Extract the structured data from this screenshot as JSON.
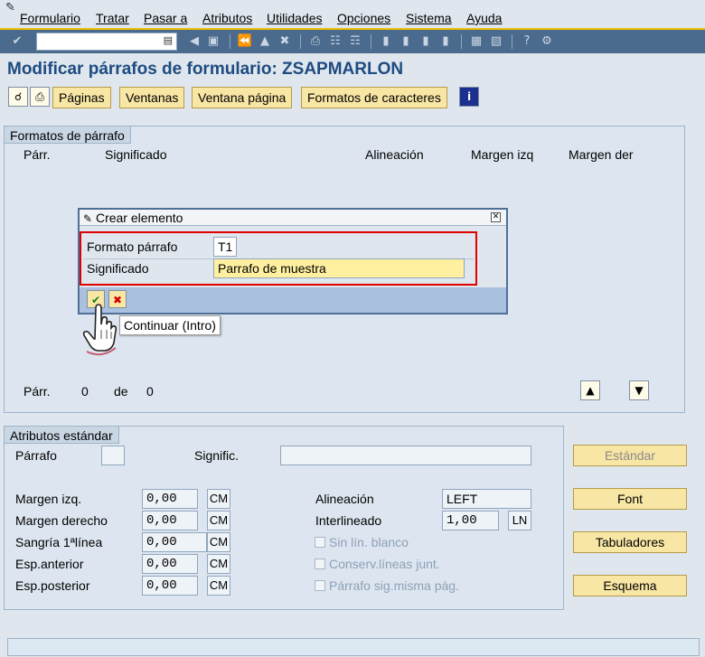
{
  "menubar": {
    "items": [
      "Formulario",
      "Tratar",
      "Pasar a",
      "Atributos",
      "Utilidades",
      "Opciones",
      "Sistema",
      "Ayuda"
    ]
  },
  "toolbar": {
    "command_value": ""
  },
  "page": {
    "title": "Modificar párrafos de formulario: ZSAPMARLON"
  },
  "appbar": {
    "buttons": [
      "Páginas",
      "Ventanas",
      "Ventana página",
      "Formatos de caracteres"
    ]
  },
  "paragraph_formats": {
    "group_title": "Formatos de párrafo",
    "columns": [
      "Párr.",
      "Significado",
      "Alineación",
      "Margen izq",
      "Margen der"
    ],
    "footer_label": "Párr.",
    "footer_count": "0",
    "footer_of": "de",
    "footer_total": "0"
  },
  "dialog": {
    "title": "Crear elemento",
    "format_label": "Formato párrafo",
    "format_value": "T1",
    "meaning_label": "Significado",
    "meaning_value": "Parrafo de muestra",
    "tooltip": "Continuar   (Intro)"
  },
  "standard_attributes": {
    "group_title": "Atributos estándar",
    "paragraph_label": "Párrafo",
    "paragraph_value": "",
    "signif_label": "Signific.",
    "signif_value": "",
    "left_margin_label": "Margen izq.",
    "left_margin_value": "0,00",
    "left_margin_unit": "CM",
    "right_margin_label": "Margen derecho",
    "right_margin_value": "0,00",
    "right_margin_unit": "CM",
    "indent_label": "Sangría 1ªlínea",
    "indent_value": "0,00",
    "indent_unit": "CM",
    "space_before_label": "Esp.anterior",
    "space_before_value": "0,00",
    "space_before_unit": "CM",
    "space_after_label": "Esp.posterior",
    "space_after_value": "0,00",
    "space_after_unit": "CM",
    "alignment_label": "Alineación",
    "alignment_value": "LEFT",
    "line_spacing_label": "Interlineado",
    "line_spacing_value": "1,00",
    "line_spacing_unit": "LN",
    "no_blank_lines": "Sin lín. blanco",
    "keep_lines": "Conserv.líneas junt.",
    "next_same_page": "Párrafo sig.misma pág."
  },
  "side_buttons": {
    "standard": "Estándar",
    "font": "Font",
    "tabs": "Tabuladores",
    "outline": "Esquema"
  },
  "colors": {
    "title_blue": "#1e4b80",
    "toolbar_blue": "#4b6b8e",
    "button_yellow": "#f8e6a4",
    "highlight_red": "#e00000",
    "input_yellow": "#fff0a0"
  }
}
